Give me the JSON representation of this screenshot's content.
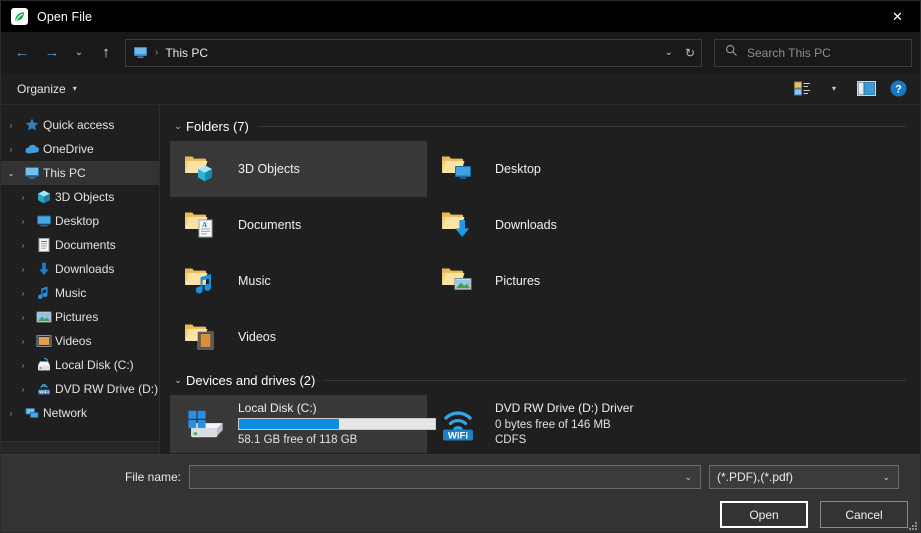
{
  "window": {
    "title": "Open File",
    "app_icon": "leaf-app-icon",
    "close_label": "✕"
  },
  "nav": {
    "back_icon": "←",
    "forward_icon": "→",
    "recent_icon": "⌄",
    "up_icon": "↑",
    "address": {
      "icon": "this-pc-icon",
      "separator": "›",
      "text": "This PC",
      "chevron": "⌄",
      "refresh": "↻"
    },
    "search": {
      "icon": "search-icon",
      "placeholder": "Search This PC"
    }
  },
  "commandbar": {
    "organize_label": "Organize",
    "organize_caret": "▾",
    "view_caret": "▾",
    "view_icon": "view-options-icon",
    "preview_icon": "preview-pane-icon",
    "help_icon": "help-icon",
    "help_glyph": "?"
  },
  "sidebar": {
    "items": [
      {
        "label": "Quick access",
        "icon": "star-icon",
        "expander": "›",
        "level": 0,
        "expanded": false,
        "selected": false
      },
      {
        "label": "OneDrive",
        "icon": "cloud-icon",
        "expander": "›",
        "level": 0,
        "expanded": false,
        "selected": false
      },
      {
        "label": "This PC",
        "icon": "monitor-icon",
        "expander": "⌄",
        "level": 0,
        "expanded": true,
        "selected": true
      },
      {
        "label": "3D Objects",
        "icon": "cube-icon",
        "expander": "›",
        "level": 1,
        "expanded": false,
        "selected": false
      },
      {
        "label": "Desktop",
        "icon": "desktop-icon",
        "expander": "›",
        "level": 1,
        "expanded": false,
        "selected": false
      },
      {
        "label": "Documents",
        "icon": "document-icon",
        "expander": "›",
        "level": 1,
        "expanded": false,
        "selected": false
      },
      {
        "label": "Downloads",
        "icon": "download-arrow-icon",
        "expander": "›",
        "level": 1,
        "expanded": false,
        "selected": false
      },
      {
        "label": "Music",
        "icon": "music-note-icon",
        "expander": "›",
        "level": 1,
        "expanded": false,
        "selected": false
      },
      {
        "label": "Pictures",
        "icon": "picture-icon",
        "expander": "›",
        "level": 1,
        "expanded": false,
        "selected": false
      },
      {
        "label": "Videos",
        "icon": "video-film-icon",
        "expander": "›",
        "level": 1,
        "expanded": false,
        "selected": false
      },
      {
        "label": "Local Disk (C:)",
        "icon": "hard-drive-icon",
        "expander": "›",
        "level": 1,
        "expanded": false,
        "selected": false
      },
      {
        "label": "DVD RW Drive (D:) D",
        "icon": "dvd-drive-icon",
        "expander": "›",
        "level": 1,
        "expanded": false,
        "selected": false
      },
      {
        "label": "Network",
        "icon": "network-icon",
        "expander": "›",
        "level": 0,
        "expanded": false,
        "selected": false
      }
    ]
  },
  "main": {
    "folders_group": {
      "caret": "⌄",
      "title": "Folders (7)",
      "items": [
        {
          "name": "3D Objects",
          "icon": "folder-3d-objects-icon",
          "selected": true
        },
        {
          "name": "Desktop",
          "icon": "folder-desktop-icon",
          "selected": false
        },
        {
          "name": "Documents",
          "icon": "folder-documents-icon",
          "selected": false
        },
        {
          "name": "Downloads",
          "icon": "folder-downloads-icon",
          "selected": false
        },
        {
          "name": "Music",
          "icon": "folder-music-icon",
          "selected": false
        },
        {
          "name": "Pictures",
          "icon": "folder-pictures-icon",
          "selected": false
        },
        {
          "name": "Videos",
          "icon": "folder-videos-icon",
          "selected": false
        }
      ]
    },
    "drives_group": {
      "caret": "⌄",
      "title": "Devices and drives (2)",
      "items": [
        {
          "name": "Local Disk (C:)",
          "icon": "hard-drive-windows-icon",
          "has_meter": true,
          "used_percent": 51,
          "detail": "58.1 GB free of 118 GB",
          "detail2": "",
          "selected": true
        },
        {
          "name": "DVD RW Drive (D:) Driver",
          "icon": "wifi-disc-icon",
          "has_meter": false,
          "used_percent": 0,
          "detail": "0 bytes free of 146 MB",
          "detail2": "CDFS",
          "selected": false
        }
      ]
    }
  },
  "footer": {
    "filename_label": "File name:",
    "filename_value": "",
    "filename_chevron": "⌄",
    "filetype_value": "(*.PDF),(*.pdf)",
    "filetype_chevron": "⌄",
    "open_label": "Open",
    "cancel_label": "Cancel"
  },
  "colors": {
    "accent": "#0a8fe0",
    "window_bg": "#1f1f1f",
    "titlebar_bg": "#000000",
    "footer_bg": "#333333",
    "selection": "#383838"
  }
}
